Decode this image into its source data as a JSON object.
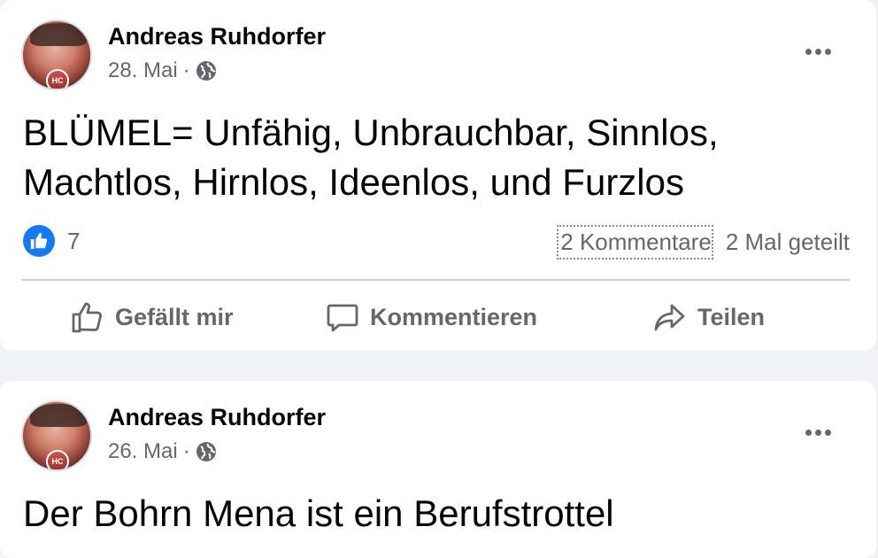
{
  "posts": [
    {
      "author": "Andreas Ruhdorfer",
      "date": "28. Mai",
      "separator": "·",
      "avatar_badge": "HC",
      "text_lines": [
        "BLÜMEL= Unfähig, Unbrauchbar, Sinnlos,",
        "Machtlos, Hirnlos, Ideenlos, und Furzlos"
      ],
      "likes": "7",
      "comments": "2 Kommentare",
      "shares": "2 Mal geteilt",
      "actions": {
        "like": "Gefällt mir",
        "comment": "Kommentieren",
        "share": "Teilen"
      }
    },
    {
      "author": "Andreas Ruhdorfer",
      "date": "26. Mai",
      "separator": "·",
      "avatar_badge": "HC",
      "text_lines": [
        "Der Bohrn Mena ist ein Berufstrottel"
      ]
    }
  ],
  "colors": {
    "like_blue": "#1877f2",
    "secondary_text": "#65676b",
    "feed_background": "#f0f2f5"
  },
  "icons": [
    "globe-icon",
    "more-options-icon",
    "like-reaction-icon",
    "thumbs-up-icon",
    "comment-icon",
    "share-icon"
  ]
}
